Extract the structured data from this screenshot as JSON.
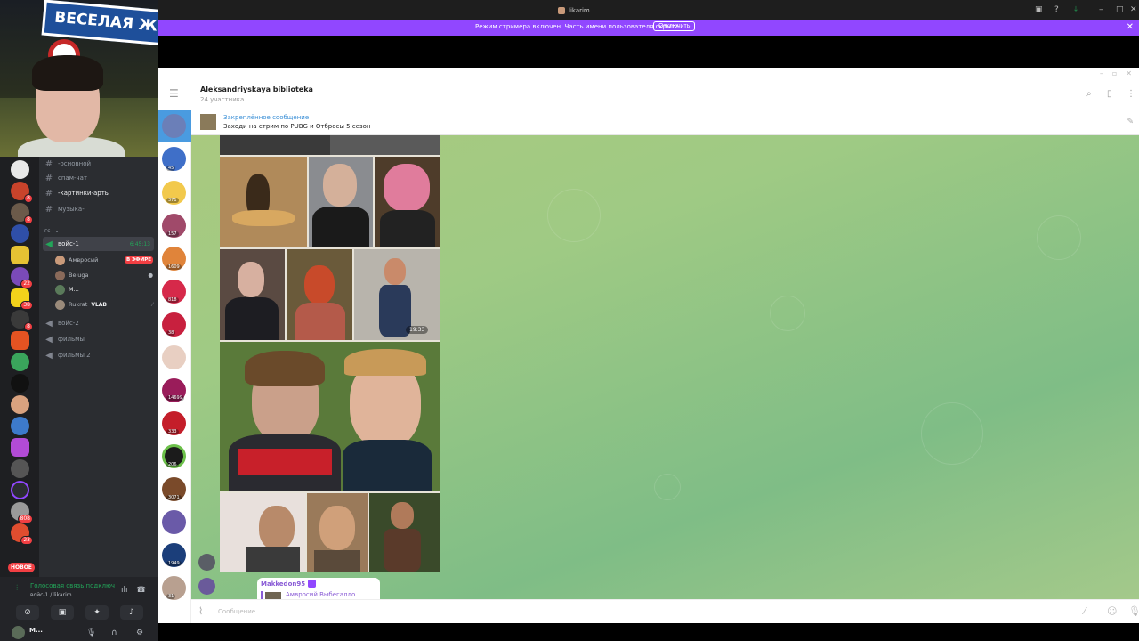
{
  "webcam": {
    "sign_text": "ВЕСЕЛАЯ ЖИЗ"
  },
  "window": {
    "title": "likarim",
    "streamer_banner": "Режим стримера включен. Часть имени пользователя скрыта.",
    "streamer_button": "Отключить"
  },
  "discord": {
    "channels": [
      {
        "label": "-основной",
        "icon": "hash-icon"
      },
      {
        "label": "спам-чат",
        "icon": "hash-icon"
      },
      {
        "label": "-картинки-арты",
        "icon": "hash-icon"
      },
      {
        "label": "музыка-",
        "icon": "hash-icon"
      }
    ],
    "category": "гс",
    "voice_channel_active": {
      "label": "войс-1",
      "time": "6:45:13"
    },
    "voice_users": [
      {
        "name": "Амвросий",
        "badge": "В ЭФИРЕ"
      },
      {
        "name": "Beluga",
        "badge": ""
      },
      {
        "name": "M...",
        "badge": ""
      },
      {
        "name": "Rukrat",
        "badge": "VLAB"
      }
    ],
    "other_voice": [
      {
        "label": "войс-2"
      },
      {
        "label": "фильмы"
      },
      {
        "label": "фильмы 2"
      }
    ],
    "new_pill": "НОВОЕ",
    "guild_badges": [
      "8",
      "8",
      "22",
      "38",
      "8",
      "808",
      "23"
    ],
    "voice_status": "Голосовая связь подключ",
    "voice_sub": "войс-1 / likarim",
    "current_user": "M..."
  },
  "telegram": {
    "chat_name": "Aleksandriyskaya biblioteka",
    "members": "24 участника",
    "pinned_label": "Закреплённое сообщение",
    "pinned_text": "Заходи на стрим по PUBG и Отбросы 5 сезон",
    "album_time": "19:33",
    "folder_badges": [
      "45",
      "371",
      "157",
      "1609",
      "818",
      "38",
      "14699",
      "333",
      "206",
      "3071",
      "1949",
      "31"
    ],
    "message_author": "Makkedon95",
    "reply_text": "Амвросий Выбегалло",
    "composer_placeholder": "Сообщение..."
  }
}
